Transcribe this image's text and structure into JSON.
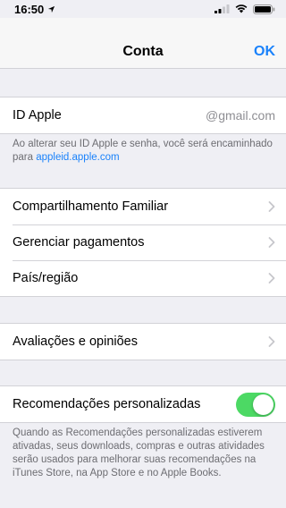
{
  "status_bar": {
    "time": "16:50",
    "icons": [
      "location-arrow-icon",
      "signal-icon",
      "wifi-icon",
      "battery-icon"
    ]
  },
  "nav": {
    "title": "Conta",
    "done_label": "OK"
  },
  "apple_id": {
    "label": "ID Apple",
    "value": "@gmail.com",
    "note_prefix": "Ao alterar seu ID Apple e senha, você será encaminhado para ",
    "note_link": "appleid.apple.com"
  },
  "menu_group": {
    "items": [
      {
        "label": "Compartilhamento Familiar"
      },
      {
        "label": "Gerenciar pagamentos"
      },
      {
        "label": "País/região"
      }
    ]
  },
  "reviews_group": {
    "items": [
      {
        "label": "Avaliações e opiniões"
      }
    ]
  },
  "recommendations": {
    "label": "Recomendações personalizadas",
    "enabled": true,
    "note": "Quando as Recomendações personalizadas estiverem ativadas, seus downloads, compras e outras atividades serão usados para melhorar suas recomendações na iTunes Store, na App Store e no Apple Books."
  },
  "colors": {
    "accent": "#1a82fb",
    "toggle_on": "#4cd964",
    "background": "#efeff4"
  }
}
